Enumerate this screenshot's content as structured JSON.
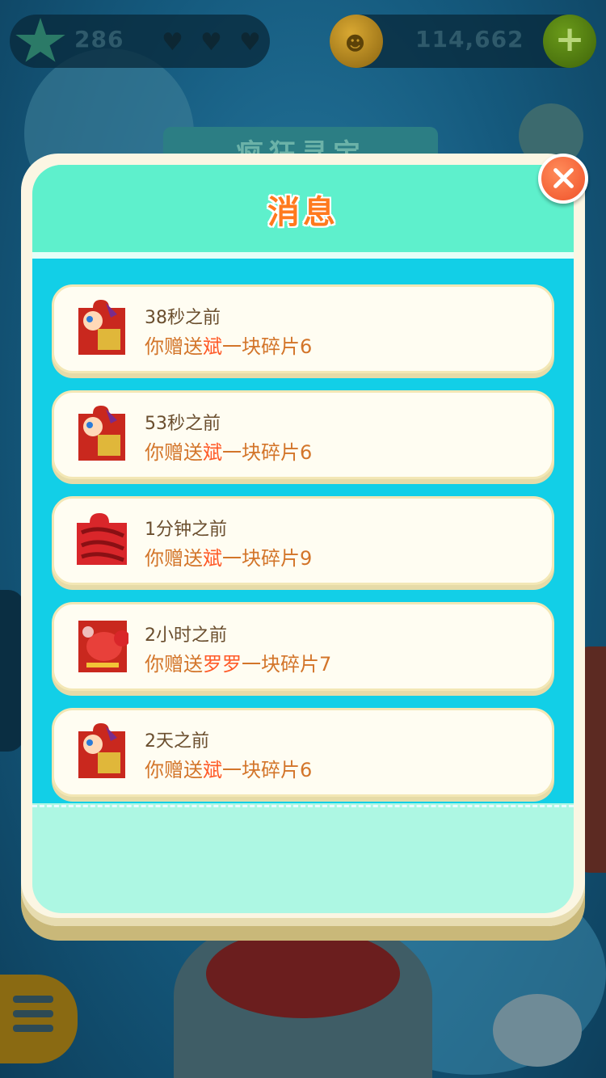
{
  "hud": {
    "star_count": "286",
    "coin_count": "114,662",
    "lives_icon": "heart-icon",
    "add_icon": "plus-icon"
  },
  "background": {
    "banner_title": "疯狂寻宝"
  },
  "dialog": {
    "title": "消息",
    "close_icon": "close-icon",
    "messages": [
      {
        "time": "38秒之前",
        "prefix": "你赠送",
        "name": "斌",
        "suffix": "一块碎片6",
        "thumb": "puzzle-piece-6"
      },
      {
        "time": "53秒之前",
        "prefix": "你赠送",
        "name": "斌",
        "suffix": "一块碎片6",
        "thumb": "puzzle-piece-6"
      },
      {
        "time": "1分钟之前",
        "prefix": "你赠送",
        "name": "斌",
        "suffix": "一块碎片9",
        "thumb": "puzzle-piece-9"
      },
      {
        "time": "2小时之前",
        "prefix": "你赠送",
        "name": "罗罗",
        "suffix": "一块碎片7",
        "thumb": "puzzle-piece-7"
      },
      {
        "time": "2天之前",
        "prefix": "你赠送",
        "name": "斌",
        "suffix": "一块碎片6",
        "thumb": "puzzle-piece-6"
      }
    ]
  },
  "colors": {
    "header": "#5ef0cc",
    "list_bg": "#12cfe7",
    "title": "#ff7a1e",
    "time_text": "#6a4e2e",
    "body_text": "#d3752a",
    "name_text": "#ff5a28"
  }
}
